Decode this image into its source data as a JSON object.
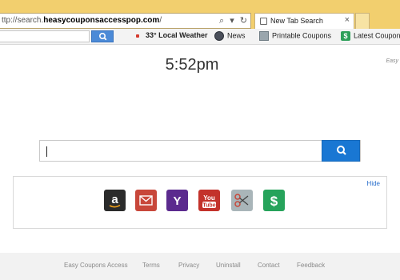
{
  "browser": {
    "url_prefix": "ttp://search.",
    "url_domain": "heasycouponsaccesspop.com",
    "url_suffix": "/",
    "tab_title": "New Tab Search",
    "tab_close": "×"
  },
  "toolbar": {
    "weather_label": "33° Local Weather",
    "news_label": "News",
    "printable_coupons_label": "Printable Coupons",
    "latest_coupons_label": "Latest Coupons"
  },
  "page": {
    "clock": "5:52pm",
    "brand": "Easy",
    "hide_label": "Hide",
    "icons": [
      "amazon-icon",
      "mail-icon",
      "yahoo-icon",
      "youtube-icon",
      "coupons-scissors-icon",
      "dollar-icon"
    ]
  },
  "footer": {
    "links": [
      "Easy Coupons Access",
      "Terms",
      "Privacy",
      "Uninstall",
      "Contact",
      "Feedback"
    ]
  },
  "colors": {
    "chrome": "#f2cf6e",
    "search_button": "#1977d3",
    "amazon": "#2b2b2b",
    "mail": "#c8473a",
    "yahoo": "#5b2a8e",
    "youtube": "#c3322b",
    "scissors": "#a9b5b9",
    "dollar": "#26a35b"
  }
}
